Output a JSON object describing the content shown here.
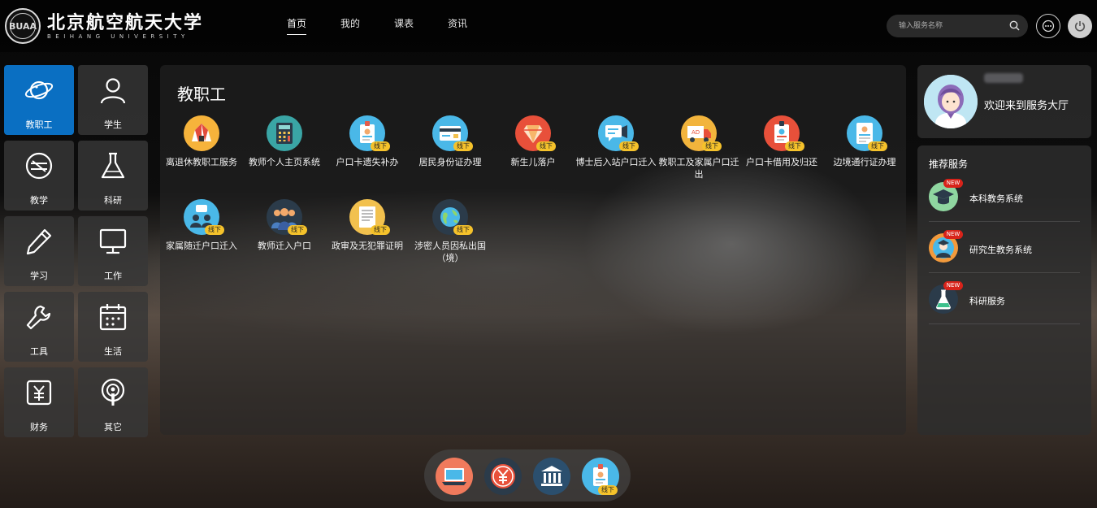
{
  "header": {
    "logo_seal_text": "BUAA",
    "logo_cn": "北京航空航天大学",
    "logo_en": "BEIHANG UNIVERSITY",
    "nav": [
      {
        "label": "首页",
        "active": true
      },
      {
        "label": "我的",
        "active": false
      },
      {
        "label": "课表",
        "active": false
      },
      {
        "label": "资讯",
        "active": false
      }
    ],
    "search_placeholder": "输入服务名称",
    "icons": {
      "search": "search-icon",
      "chat": "chat-icon",
      "power": "power-icon"
    }
  },
  "sidebar": {
    "active_color": "#0a6fc2",
    "categories": [
      {
        "label": "教职工",
        "icon": "planet-icon",
        "active": true
      },
      {
        "label": "学生",
        "icon": "user-icon",
        "active": false
      },
      {
        "label": "教学",
        "icon": "teaching-icon",
        "active": false
      },
      {
        "label": "科研",
        "icon": "flask-icon",
        "active": false
      },
      {
        "label": "学习",
        "icon": "pencil-icon",
        "active": false
      },
      {
        "label": "工作",
        "icon": "monitor-icon",
        "active": false
      },
      {
        "label": "工具",
        "icon": "wrench-icon",
        "active": false
      },
      {
        "label": "生活",
        "icon": "calendar-icon",
        "active": false
      },
      {
        "label": "财务",
        "icon": "finance-icon",
        "active": false
      },
      {
        "label": "其它",
        "icon": "podcast-icon",
        "active": false
      }
    ]
  },
  "main": {
    "title": "教职工",
    "offline_badge": "线下",
    "services": [
      {
        "label": "离退休教职工服务",
        "icon": "circus-tent-icon",
        "offline": false
      },
      {
        "label": "教师个人主页系统",
        "icon": "calculator-icon",
        "offline": false
      },
      {
        "label": "户口卡遗失补办",
        "icon": "id-badge-icon",
        "offline": true
      },
      {
        "label": "居民身份证办理",
        "icon": "id-card-icon",
        "offline": true
      },
      {
        "label": "新生儿落户",
        "icon": "newborn-icon",
        "offline": true
      },
      {
        "label": "博士后入站户口迁入",
        "icon": "chat-screen-icon",
        "offline": true
      },
      {
        "label": "教职工及家属户口迁出",
        "icon": "moving-truck-icon",
        "offline": true
      },
      {
        "label": "户口卡借用及归还",
        "icon": "badge-icon",
        "offline": true
      },
      {
        "label": "边境通行证办理",
        "icon": "document-icon",
        "offline": true
      },
      {
        "label": "家属随迁户口迁入",
        "icon": "family-icon",
        "offline": true
      },
      {
        "label": "教师迁入户口",
        "icon": "teachers-icon",
        "offline": true
      },
      {
        "label": "政审及无犯罪证明",
        "icon": "certificate-icon",
        "offline": true
      },
      {
        "label": "涉密人员因私出国（境）",
        "icon": "globe-icon",
        "offline": true
      }
    ]
  },
  "welcome": {
    "text": "欢迎来到服务大厅",
    "avatar": "avatar-icon"
  },
  "recommended": {
    "title": "推荐服务",
    "new_badge": "NEW",
    "items": [
      {
        "label": "本科教务系统",
        "icon": "graduation-cap-icon"
      },
      {
        "label": "研究生教务系统",
        "icon": "graduate-icon"
      },
      {
        "label": "科研服务",
        "icon": "research-flask-icon"
      }
    ]
  },
  "dock": {
    "offline_badge": "线下",
    "items": [
      {
        "icon": "computer-icon"
      },
      {
        "icon": "yuan-coin-icon"
      },
      {
        "icon": "bank-icon"
      },
      {
        "icon": "id-badge-icon",
        "offline": true
      }
    ]
  }
}
